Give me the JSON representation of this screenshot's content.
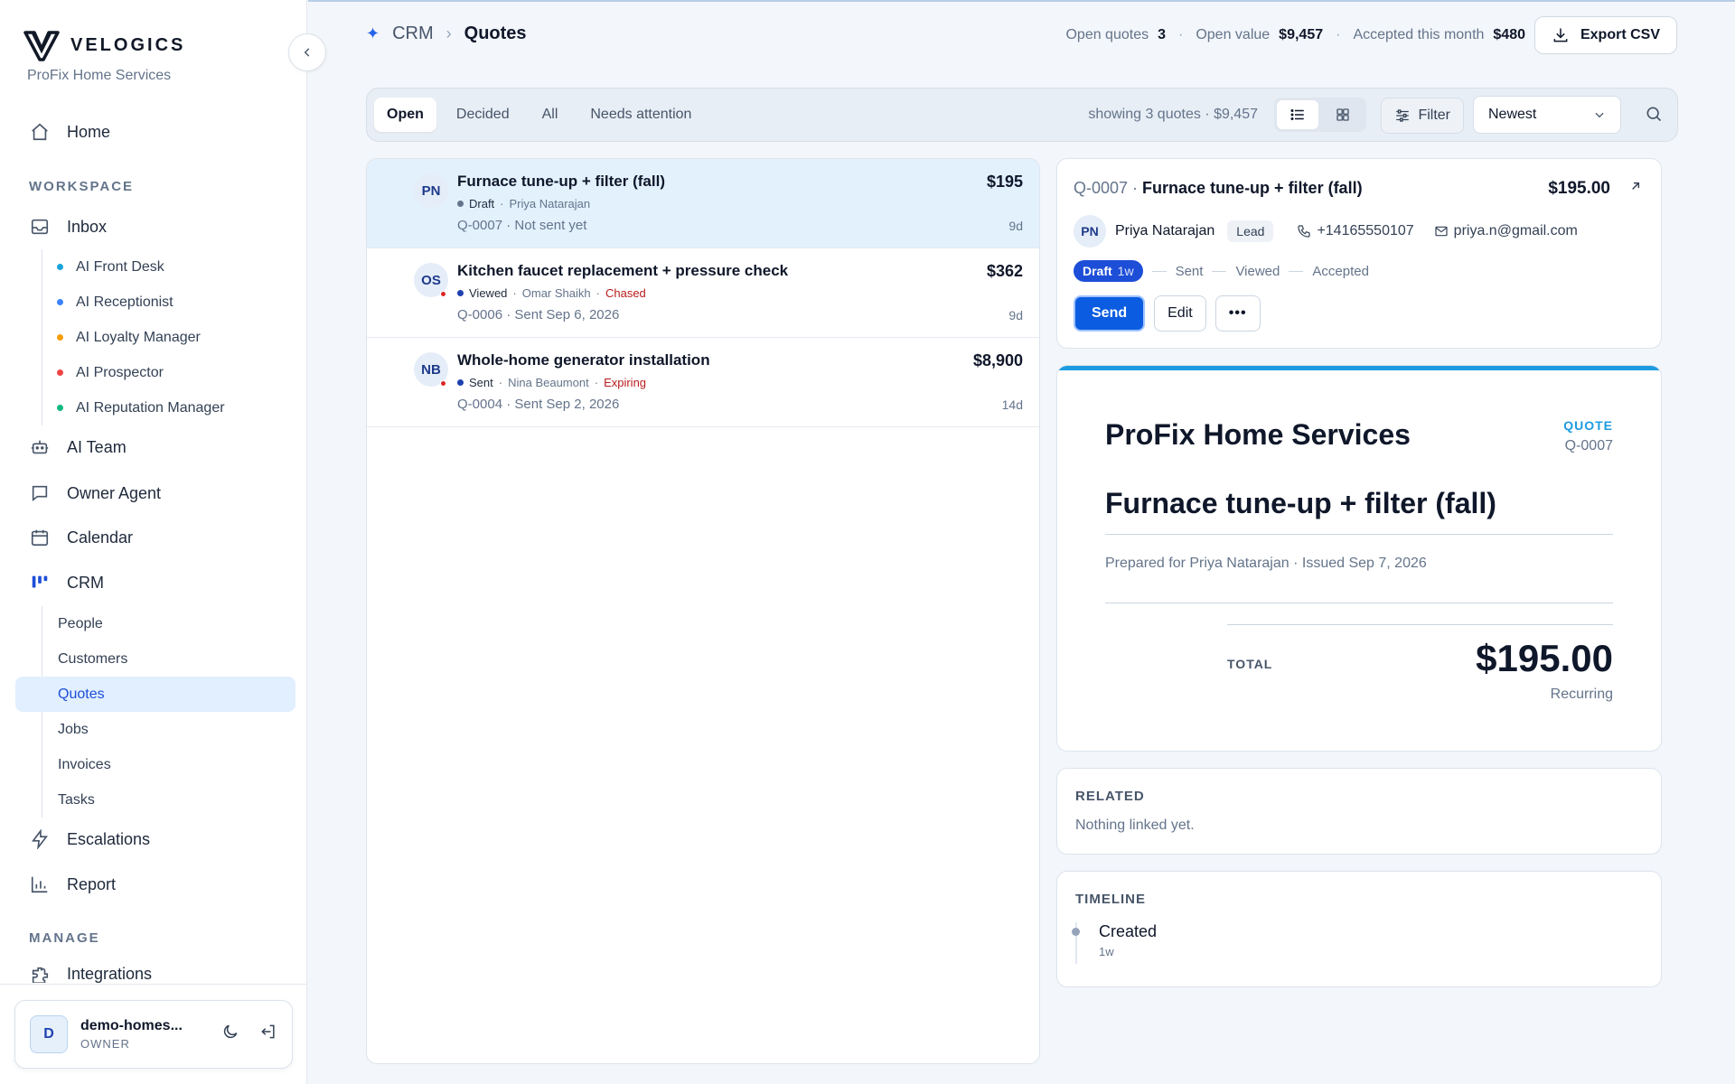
{
  "brand": {
    "name": "VELOGICS",
    "org": "ProFix Home Services"
  },
  "sidebar": {
    "home": "Home",
    "workspace_label": "WORKSPACE",
    "inbox": "Inbox",
    "inbox_items": [
      {
        "label": "AI Front Desk",
        "color": "#1aa3d9"
      },
      {
        "label": "AI Receptionist",
        "color": "#3b82f6"
      },
      {
        "label": "AI Loyalty Manager",
        "color": "#f59e0b"
      },
      {
        "label": "AI Prospector",
        "color": "#ef4444"
      },
      {
        "label": "AI Reputation Manager",
        "color": "#10b981"
      }
    ],
    "ai_team": "AI Team",
    "owner_agent": "Owner Agent",
    "calendar": "Calendar",
    "crm": "CRM",
    "crm_items": [
      "People",
      "Customers",
      "Quotes",
      "Jobs",
      "Invoices",
      "Tasks"
    ],
    "crm_active": "Quotes",
    "escalations": "Escalations",
    "report": "Report",
    "manage_label": "MANAGE",
    "integrations": "Integrations"
  },
  "user": {
    "initial": "D",
    "name": "demo-homes...",
    "role": "OWNER"
  },
  "header": {
    "crumb_root": "CRM",
    "crumb_current": "Quotes",
    "stats": {
      "open_quotes_label": "Open quotes",
      "open_quotes": "3",
      "open_value_label": "Open value",
      "open_value": "$9,457",
      "accepted_label": "Accepted this month",
      "accepted": "$480"
    },
    "export_label": "Export CSV"
  },
  "toolbar": {
    "tabs": [
      "Open",
      "Decided",
      "All",
      "Needs attention"
    ],
    "active_tab": "Open",
    "showing": "showing 3 quotes · $9,457",
    "filter_label": "Filter",
    "sort_value": "Newest"
  },
  "quotes": [
    {
      "initials": "PN",
      "title": "Furnace tune-up + filter (fall)",
      "amount": "$195",
      "status": "Draft",
      "status_color": "#64748b",
      "person": "Priya Natarajan",
      "flag": "",
      "id": "Q-0007",
      "sent": "Not sent yet",
      "age": "9d",
      "alert": false
    },
    {
      "initials": "OS",
      "title": "Kitchen faucet replacement + pressure check",
      "amount": "$362",
      "status": "Viewed",
      "status_color": "#1e40af",
      "person": "Omar Shaikh",
      "flag": "Chased",
      "id": "Q-0006",
      "sent": "Sent Sep 6, 2026",
      "age": "9d",
      "alert": true
    },
    {
      "initials": "NB",
      "title": "Whole-home generator installation",
      "amount": "$8,900",
      "status": "Sent",
      "status_color": "#1e40af",
      "person": "Nina Beaumont",
      "flag": "Expiring",
      "id": "Q-0004",
      "sent": "Sent Sep 2, 2026",
      "age": "14d",
      "alert": true
    }
  ],
  "detail": {
    "id": "Q-0007",
    "title": "Furnace tune-up + filter (fall)",
    "amount": "$195.00",
    "contact": {
      "initials": "PN",
      "name": "Priya Natarajan",
      "tag": "Lead",
      "phone": "+14165550107",
      "email": "priya.n@gmail.com"
    },
    "stages": {
      "current": "Draft",
      "current_age": "1w",
      "next": [
        "Sent",
        "Viewed",
        "Accepted"
      ]
    },
    "actions": {
      "send": "Send",
      "edit": "Edit",
      "more": "•••"
    }
  },
  "doc": {
    "company": "ProFix Home Services",
    "label": "QUOTE",
    "number": "Q-0007",
    "title": "Furnace tune-up + filter (fall)",
    "prepared": "Prepared for Priya Natarajan · Issued Sep 7, 2026",
    "total_label": "TOTAL",
    "total": "$195.00",
    "recurring": "Recurring"
  },
  "related": {
    "title": "RELATED",
    "body": "Nothing linked yet."
  },
  "timeline": {
    "title": "TIMELINE",
    "items": [
      {
        "label": "Created",
        "time": "1w"
      }
    ]
  }
}
